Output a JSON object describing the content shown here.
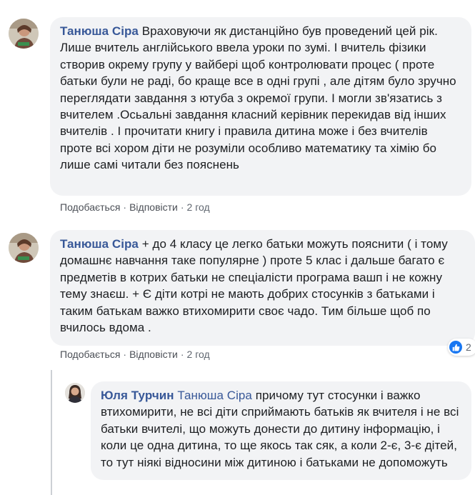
{
  "colors": {
    "bubble_bg": "#f2f3f5",
    "author_link": "#385898",
    "meta_text": "#606770",
    "like_blue": "#1877f2",
    "thread_line": "#ccd0d5"
  },
  "comments": [
    {
      "author": "Танюша Сіра",
      "text": "Враховуючи як дистанційно був проведений цей рік. Лише вчитель англійського ввела уроки по зумі. І вчитель фізики створив окрему групу у вайбері щоб контролювати процес ( проте батьки були не раді, бо краще все в одні групі , але дітям було зручно переглядати завдання з ютуба з окремої групи. І могли зв'язатись з вчителем .Осьальні завдання класний керівник перекидав від інших вчителів . І прочитати книгу і правила дитина може і без вчителів проте всі хором діти не розуміли особливо математику та хімію бо лише самі читали без пояснень",
      "like_label": "Подобається",
      "reply_label": "Відповісти",
      "time": "2 год",
      "avatar_icon": "user-avatar-icon"
    },
    {
      "author": "Танюша Сіра",
      "text": "+ до 4 класу це легко батьки можуть пояснити ( і тому домашнє навчання таке популярне ) проте 5 клас і дальше багато є предметів в котрих батьки не спеціалісти програма вашп і не кожну тему знаєш. + Є діти котрі не мають добрих стосунків з батьками і таким батькам важко втихомирити своє чадо. Тим більше щоб по вчилось вдома .",
      "like_label": "Подобається",
      "reply_label": "Відповісти",
      "time": "2 год",
      "avatar_icon": "user-avatar-icon",
      "reaction_icon": "like-icon",
      "reaction_count": "2"
    }
  ],
  "reply": {
    "author": "Юля Турчин",
    "mention": "Танюша Сіра",
    "text": "причому тут стосунки і важко втихомирити, не всі діти сприймають батьків як вчителя і не всі батьки вчителі, що можуть донести до дитину інформацію, і коли це одна дитина, то ще якось так сяк, а коли 2-є, 3-є дітей, то тут ніякі відносини між дитиною і батьками не допоможуть",
    "avatar_icon": "user-avatar-icon"
  }
}
